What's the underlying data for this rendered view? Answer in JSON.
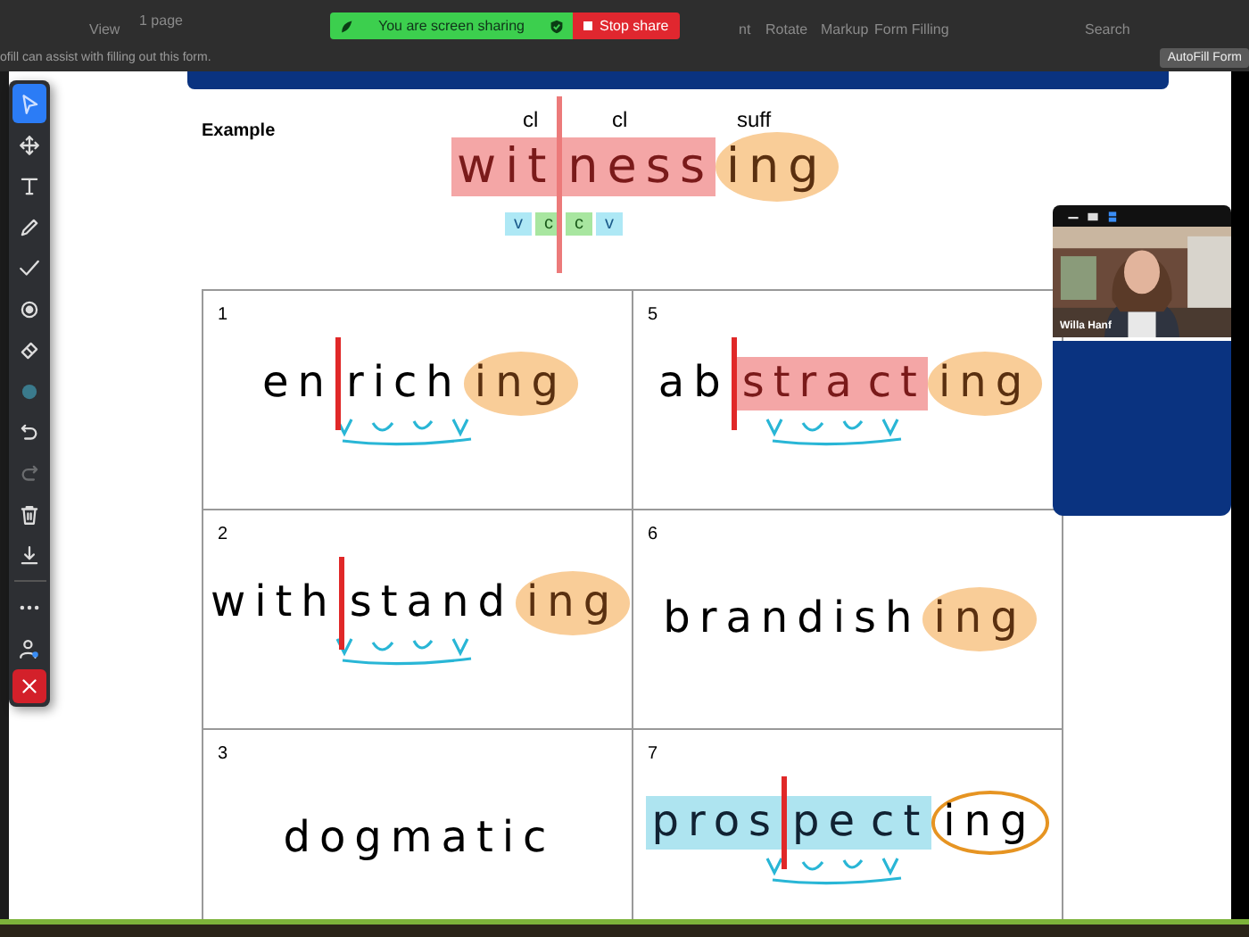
{
  "menu_bar": {
    "items": [
      "View",
      "1 page",
      "nt",
      "Rotate",
      "Markup",
      "Form Filling",
      "Search"
    ]
  },
  "share_banner": {
    "status": "You are screen sharing",
    "stop_label": "Stop share"
  },
  "autofill": {
    "message": "ofill can assist with filling out this form.",
    "button": "AutoFill Form"
  },
  "toolbar": {
    "tools": [
      {
        "kind": "select",
        "selected": true,
        "disabled": false
      },
      {
        "kind": "move",
        "selected": false,
        "disabled": false
      },
      {
        "kind": "text",
        "selected": false,
        "disabled": false
      },
      {
        "kind": "draw",
        "selected": false,
        "disabled": false
      },
      {
        "kind": "stamp",
        "selected": false,
        "disabled": false
      },
      {
        "kind": "spotlight",
        "selected": false,
        "disabled": false
      },
      {
        "kind": "eraser",
        "selected": false,
        "disabled": false
      },
      {
        "kind": "color",
        "selected": false,
        "disabled": false,
        "color": "#3a7a8c"
      },
      {
        "kind": "undo",
        "selected": false,
        "disabled": false
      },
      {
        "kind": "redo",
        "selected": false,
        "disabled": true
      },
      {
        "kind": "clear",
        "selected": false,
        "disabled": false
      },
      {
        "kind": "save",
        "selected": false,
        "disabled": false
      },
      {
        "kind": "more",
        "selected": false,
        "disabled": false
      },
      {
        "kind": "user",
        "selected": false,
        "disabled": false
      },
      {
        "kind": "close",
        "selected": false,
        "disabled": false
      }
    ]
  },
  "example": {
    "title": "Example",
    "labels": [
      "cl",
      "cl",
      "suff"
    ],
    "parts": [
      {
        "text": "wit",
        "kind": "pink",
        "divider": false
      },
      {
        "text": "ness",
        "kind": "pink",
        "divider": true
      },
      {
        "text": "ing",
        "kind": "suffix",
        "divider": false
      }
    ],
    "tags": [
      {
        "text": "v",
        "kind": "vowel"
      },
      {
        "text": "c",
        "kind": "consonant"
      },
      {
        "text": "c",
        "kind": "consonant"
      },
      {
        "text": "v",
        "kind": "vowel"
      }
    ]
  },
  "cells": [
    {
      "number": "1",
      "inked": true,
      "parts": [
        {
          "text": "en",
          "kind": "plain",
          "divider": false
        },
        {
          "text": "rich",
          "kind": "plain",
          "divider": true
        },
        {
          "text": "ing",
          "kind": "suffix",
          "divider": false
        }
      ]
    },
    {
      "number": "5",
      "inked": true,
      "parts": [
        {
          "text": "ab",
          "kind": "plain",
          "divider": false
        },
        {
          "text": "stra",
          "kind": "pink",
          "divider": true
        },
        {
          "text": "ct",
          "kind": "pink",
          "divider": false
        },
        {
          "text": "ing",
          "kind": "suffix",
          "divider": false
        }
      ]
    },
    {
      "number": "2",
      "inked": true,
      "parts": [
        {
          "text": "with",
          "kind": "plain",
          "divider": false
        },
        {
          "text": "stand",
          "kind": "plain",
          "divider": true
        },
        {
          "text": "ing",
          "kind": "suffix",
          "divider": false
        }
      ]
    },
    {
      "number": "6",
      "inked": false,
      "parts": [
        {
          "text": "brandish",
          "kind": "plain",
          "divider": false
        },
        {
          "text": "ing",
          "kind": "suffix",
          "divider": false
        }
      ]
    },
    {
      "number": "3",
      "inked": false,
      "parts": [
        {
          "text": "dogmatic",
          "kind": "plain",
          "divider": false
        }
      ]
    },
    {
      "number": "7",
      "inked": true,
      "parts": [
        {
          "text": "pros",
          "kind": "blue",
          "divider": false
        },
        {
          "text": "pe",
          "kind": "blue",
          "divider": true
        },
        {
          "text": "ct",
          "kind": "blue",
          "divider": false
        },
        {
          "text": "ing",
          "kind": "ring",
          "divider": false
        }
      ]
    }
  ],
  "video": {
    "name": "Willa Hanf"
  }
}
